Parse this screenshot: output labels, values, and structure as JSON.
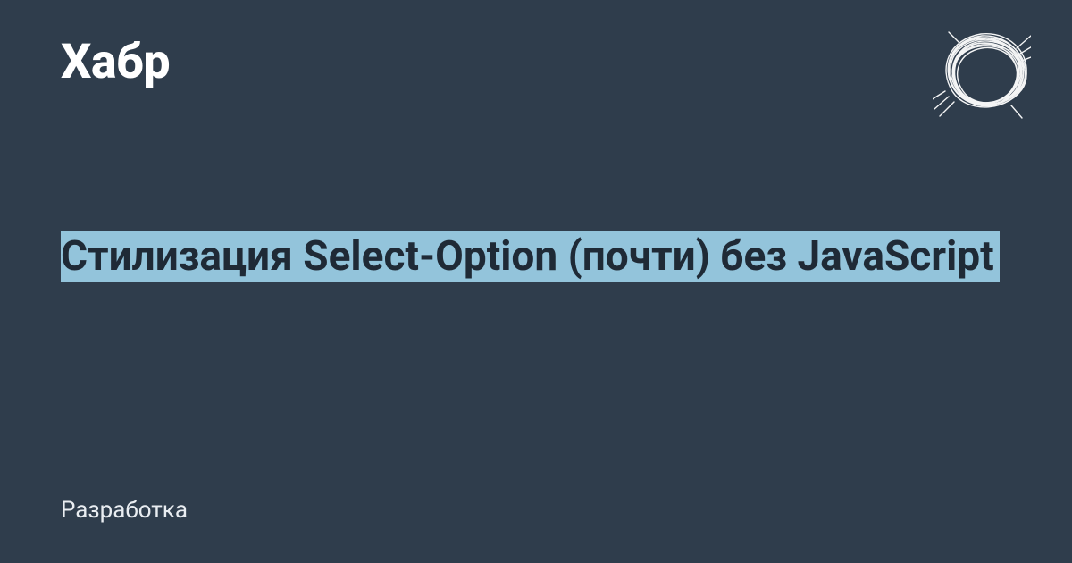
{
  "logo": "Хабр",
  "title": "Стилизация Select-Option (почти) без JavaScript",
  "category": "Разработка",
  "colors": {
    "background": "#2f3d4c",
    "highlight": "#93c4db",
    "title_text": "#1f2a36",
    "text": "#ffffff"
  },
  "icon": "scribble-icon"
}
